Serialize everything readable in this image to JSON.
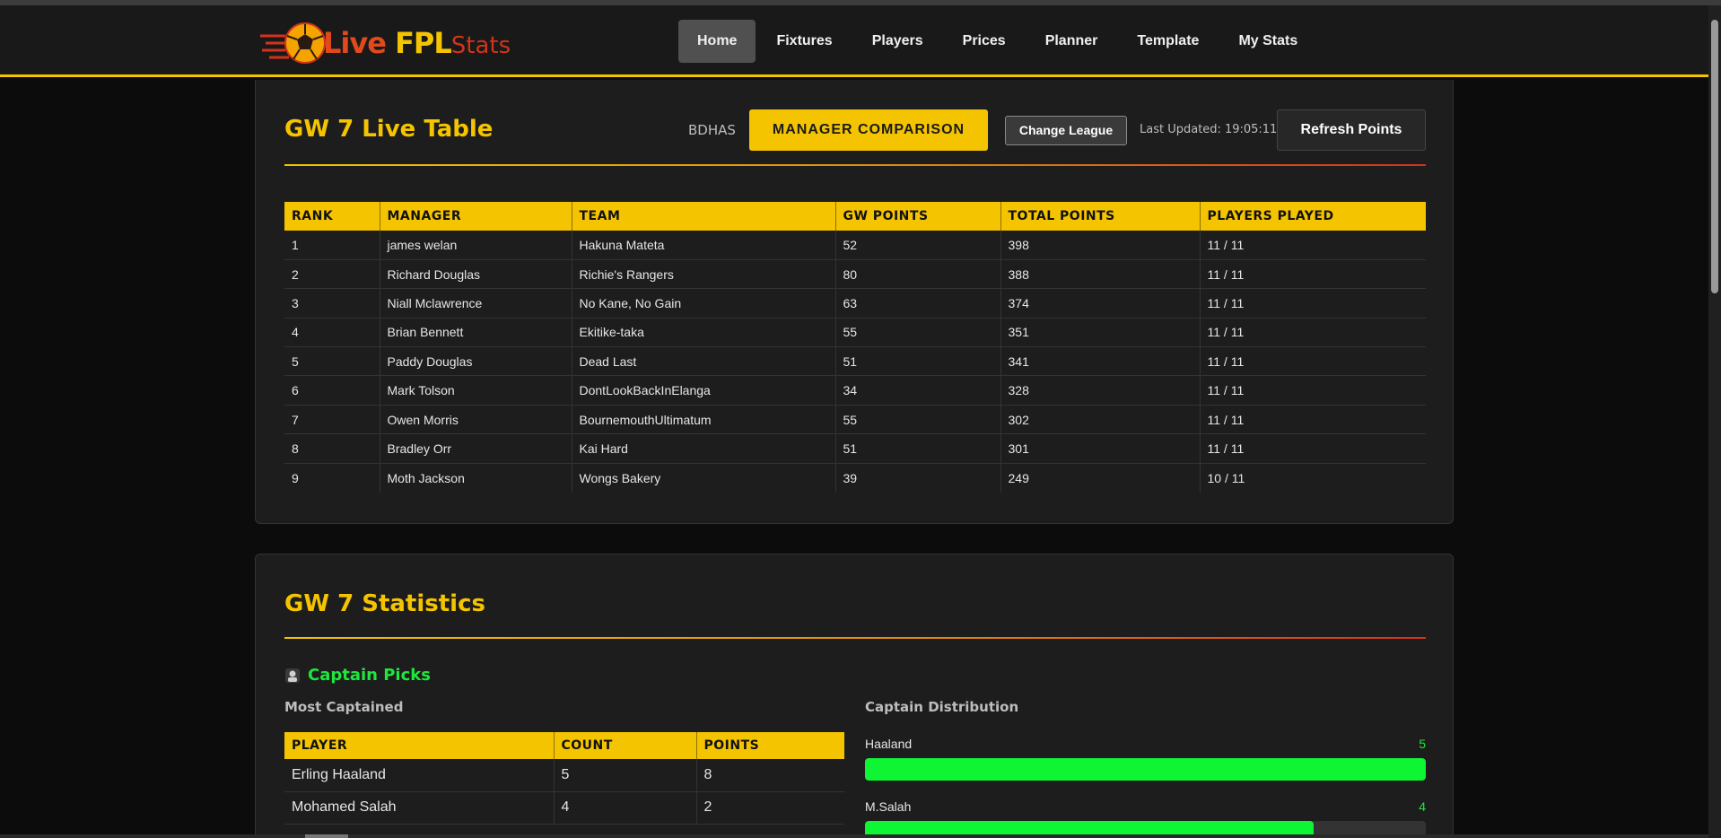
{
  "brand": {
    "live": "Live",
    "fpl": "FPL",
    "stats": "Stats"
  },
  "nav": [
    "Home",
    "Fixtures",
    "Players",
    "Prices",
    "Planner",
    "Template",
    "My Stats"
  ],
  "live_table": {
    "title": "GW 7 Live Table",
    "league_code": "BDHAS",
    "compare_label": "MANAGER COMPARISON",
    "change_league_label": "Change League",
    "last_updated_label": "Last Updated:",
    "last_updated_time": "19:05:11",
    "refresh_label": "Refresh Points",
    "headers": [
      "RANK",
      "MANAGER",
      "TEAM",
      "GW POINTS",
      "TOTAL POINTS",
      "PLAYERS PLAYED"
    ],
    "rows": [
      [
        "1",
        "james welan",
        "Hakuna Mateta",
        "52",
        "398",
        "11 / 11"
      ],
      [
        "2",
        "Richard Douglas",
        "Richie's Rangers",
        "80",
        "388",
        "11 / 11"
      ],
      [
        "3",
        "Niall Mclawrence",
        "No Kane, No Gain",
        "63",
        "374",
        "11 / 11"
      ],
      [
        "4",
        "Brian Bennett",
        "Ekitike-taka",
        "55",
        "351",
        "11 / 11"
      ],
      [
        "5",
        "Paddy Douglas",
        "Dead Last",
        "51",
        "341",
        "11 / 11"
      ],
      [
        "6",
        "Mark Tolson",
        "DontLookBackInElanga",
        "34",
        "328",
        "11 / 11"
      ],
      [
        "7",
        "Owen Morris",
        "BournemouthUltimatum",
        "55",
        "302",
        "11 / 11"
      ],
      [
        "8",
        "Bradley Orr",
        "Kai Hard",
        "51",
        "301",
        "11 / 11"
      ],
      [
        "9",
        "Moth Jackson",
        "Wongs Bakery",
        "39",
        "249",
        "10 / 11"
      ]
    ]
  },
  "statistics": {
    "title": "GW 7 Statistics",
    "captain_heading": "Captain Picks",
    "most_captained_label": "Most Captained",
    "distribution_label": "Captain Distribution",
    "captain_headers": [
      "PLAYER",
      "COUNT",
      "POINTS"
    ],
    "captain_rows": [
      [
        "Erling Haaland",
        "5",
        "8"
      ],
      [
        "Mohamed Salah",
        "4",
        "2"
      ]
    ],
    "distribution": [
      {
        "name": "Haaland",
        "count": "5",
        "fraction": 1.0
      },
      {
        "name": "M.Salah",
        "count": "4",
        "fraction": 0.8
      }
    ]
  },
  "colors": {
    "accent": "#f5c400",
    "green": "#0ef534",
    "red": "#d2331a"
  }
}
